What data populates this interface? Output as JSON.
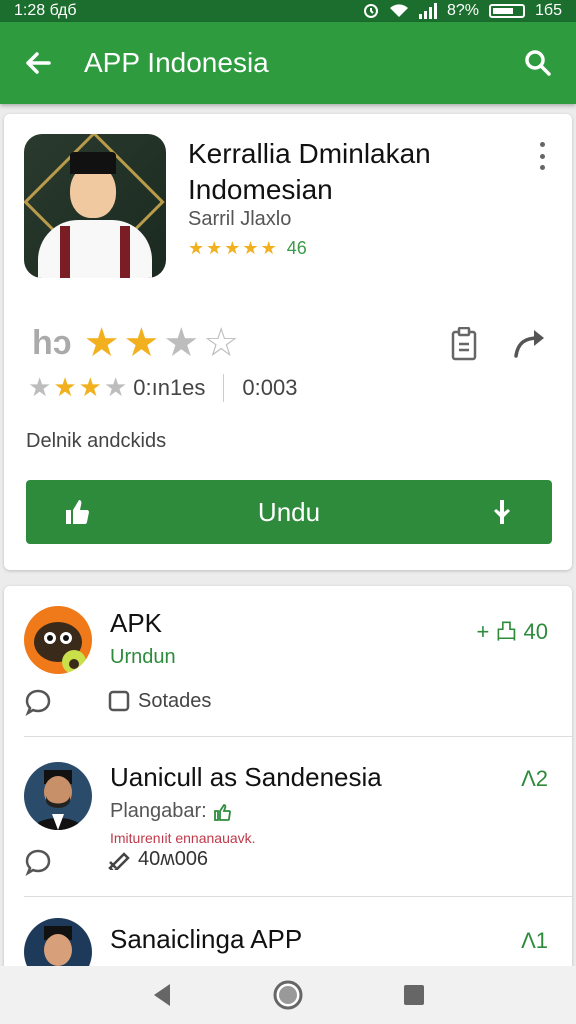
{
  "status_bar": {
    "time": "1:28 бдб",
    "battery_text": "8?%",
    "right_text": "1б5"
  },
  "app_bar": {
    "title": "APP Indonesia"
  },
  "app": {
    "title_line1": "Kerrallia Dminlakan",
    "title_line2": "Indomesian",
    "developer": "Sarril Jlaxlo",
    "rating_count": "46",
    "big_rating_label": "hɔ",
    "small_text": "0:ın1es",
    "small_value": "0:003",
    "description": "Delnik andckids",
    "install_label": "Undu"
  },
  "list": [
    {
      "name": "APK",
      "sub": "Urndun",
      "right": "+ 凸 40",
      "meta": "Sotades"
    },
    {
      "name": "Uanicull as Sandenesia",
      "sub": "Plangabar:",
      "sub2": "Imiturenıit ennanauavk.",
      "right": "Λ2",
      "meta": "40ʍ006"
    },
    {
      "name": "Sanaiclinga APP",
      "right": "Λ1"
    }
  ],
  "colors": {
    "primary": "#2e9b3f",
    "status_bar": "#1b6e2e",
    "install": "#2e8b3c",
    "star": "#f2b01e"
  }
}
